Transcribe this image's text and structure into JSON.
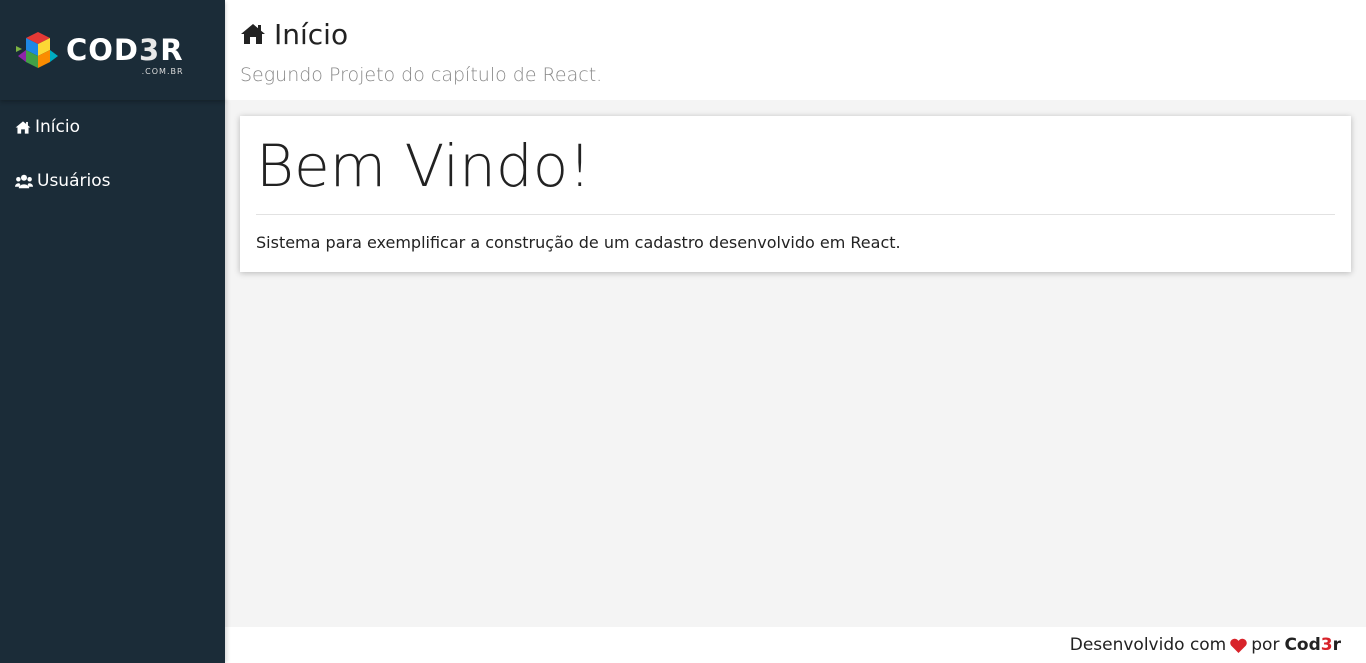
{
  "logo": {
    "name_prefix": "COD",
    "name_three": "3",
    "name_suffix": "R",
    "domain": ".COM.BR"
  },
  "header": {
    "icon": "home-icon",
    "title": "Início",
    "subtitle": "Segundo Projeto do capítulo de React."
  },
  "sidebar": {
    "items": [
      {
        "icon": "home-icon",
        "label": "Início"
      },
      {
        "icon": "users-icon",
        "label": "Usuários"
      }
    ]
  },
  "main": {
    "card": {
      "title": "Bem Vindo!",
      "text": "Sistema para exemplificar a construção de um cadastro desenvolvido em React."
    }
  },
  "footer": {
    "prefix": "Desenvolvido com",
    "icon": "heart-icon",
    "middle": "por",
    "brand_part1": "Cod",
    "brand_accent": "3",
    "brand_part2": "r"
  },
  "colors": {
    "sidebar_bg": "#1b2c38",
    "content_bg": "#f4f4f4",
    "heart": "#d8232a"
  }
}
